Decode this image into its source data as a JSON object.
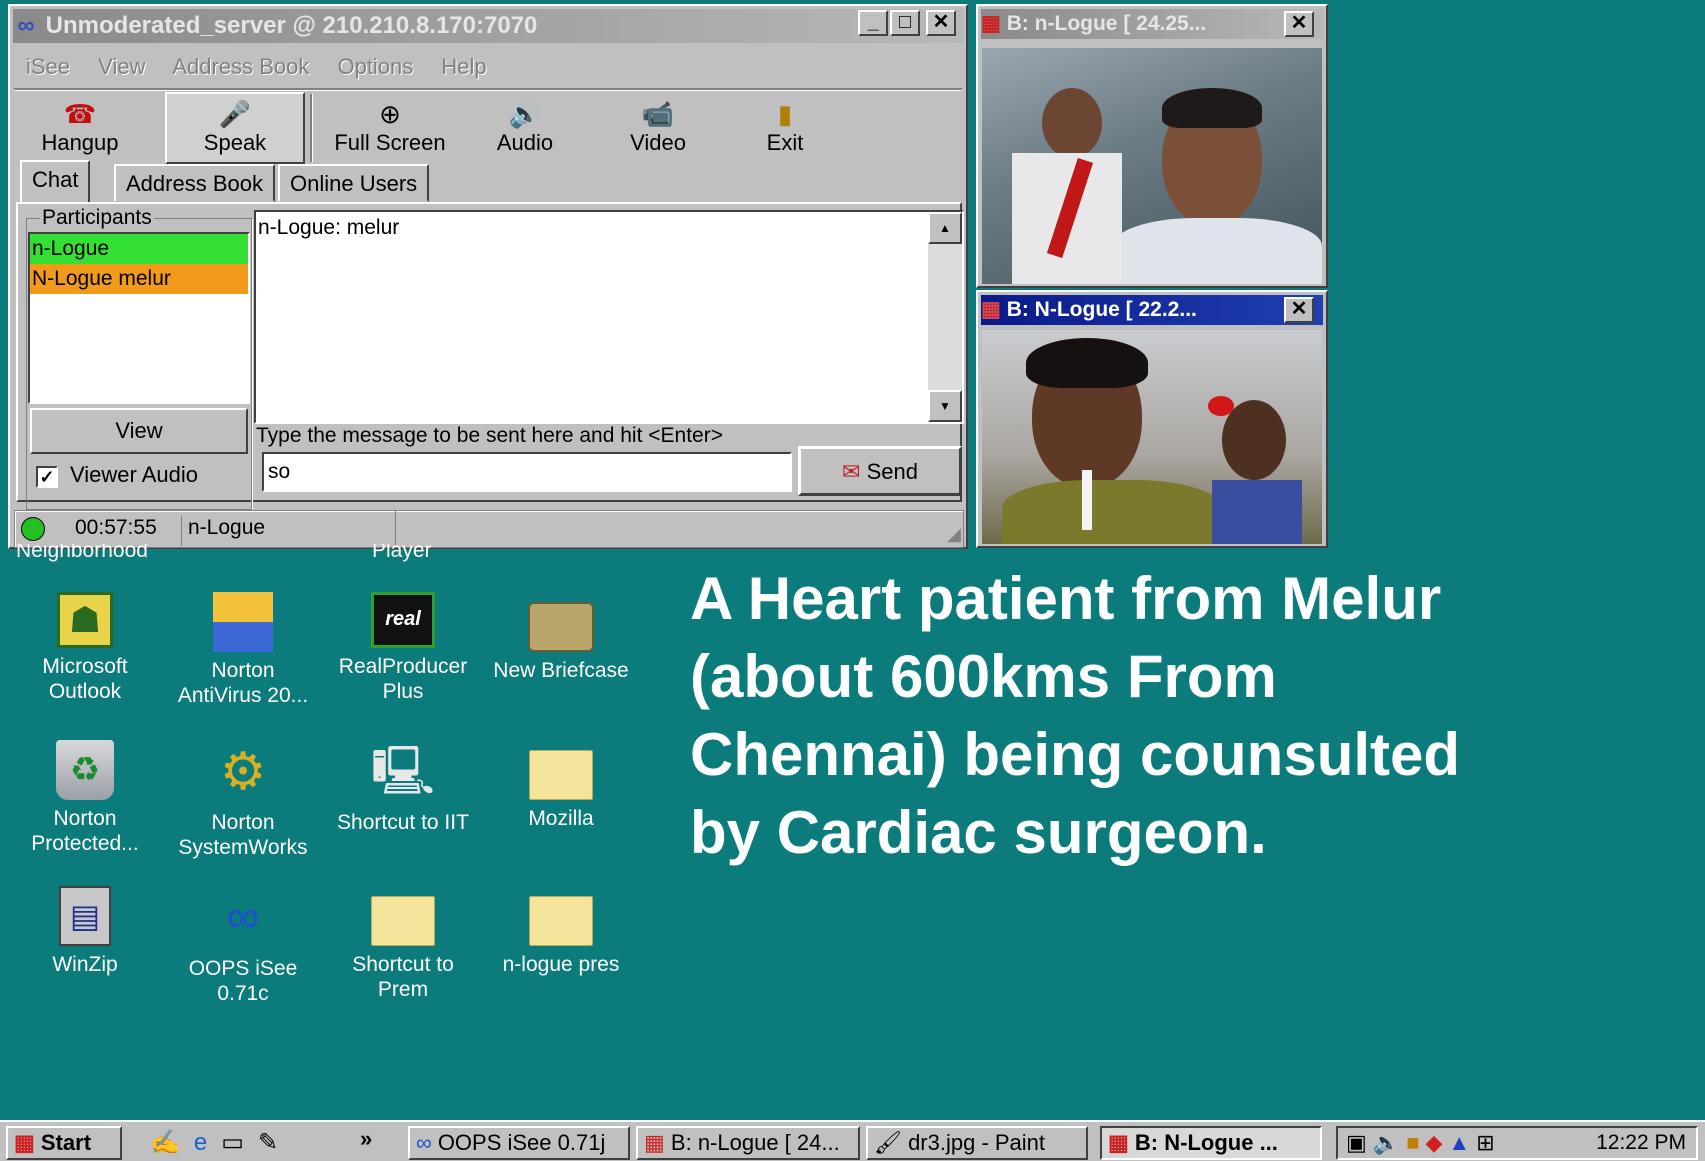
{
  "main_window": {
    "title": "Unmoderated_server @ 210.210.8.170:7070",
    "menu": [
      "iSee",
      "View",
      "Address Book",
      "Options",
      "Help"
    ],
    "toolbar": [
      {
        "label": "Hangup",
        "icon": "phone-icon"
      },
      {
        "label": "Speak",
        "icon": "microphone-icon"
      },
      {
        "label": "Full Screen",
        "icon": "magnifier-icon"
      },
      {
        "label": "Audio",
        "icon": "speaker-icon"
      },
      {
        "label": "Video",
        "icon": "camera-icon"
      },
      {
        "label": "Exit",
        "icon": "door-icon"
      }
    ],
    "tabs": [
      "Chat",
      "Address Book",
      "Online Users"
    ],
    "participants_label": "Participants",
    "participants": [
      "n-Logue",
      "N-Logue melur"
    ],
    "chat_log": "n-Logue: melur",
    "view_button": "View",
    "viewer_audio_label": "Viewer Audio",
    "viewer_audio_checked": true,
    "message_hint": "Type the message to be sent here and hit <Enter>",
    "message_value": "so",
    "send_button": "Send",
    "status_time": "00:57:55",
    "status_user": "n-Logue"
  },
  "video_windows": [
    {
      "title": "B: n-Logue [ 24.25..."
    },
    {
      "title": "B: N-Logue [ 22.2..."
    }
  ],
  "desktop": {
    "partial_labels": [
      "Neighborhood",
      "Player"
    ],
    "icons": [
      {
        "label": "Microsoft Outlook",
        "icon": "outlook-icon"
      },
      {
        "label": "Norton AntiVirus 20...",
        "icon": "norton-antivirus-icon"
      },
      {
        "label": "RealProducer Plus",
        "icon": "realproducer-icon"
      },
      {
        "label": "New Briefcase",
        "icon": "briefcase-icon"
      },
      {
        "label": "Norton Protected...",
        "icon": "recycle-bin-icon"
      },
      {
        "label": "Norton SystemWorks",
        "icon": "norton-systemworks-icon"
      },
      {
        "label": "Shortcut to IIT",
        "icon": "network-computer-icon"
      },
      {
        "label": "Mozilla",
        "icon": "folder-icon"
      },
      {
        "label": "WinZip",
        "icon": "winzip-icon"
      },
      {
        "label": "OOPS iSee 0.71c",
        "icon": "isee-icon"
      },
      {
        "label": "Shortcut to Prem",
        "icon": "folder-icon"
      },
      {
        "label": "n-logue pres",
        "icon": "folder-icon"
      }
    ],
    "caption": [
      "A Heart patient from Melur",
      "(about 600kms From",
      "Chennai) being counsulted",
      "by Cardiac surgeon."
    ]
  },
  "taskbar": {
    "start": "Start",
    "quicklaunch_more": "»",
    "tasks": [
      "OOPS iSee 0.71j",
      "B: n-Logue [ 24...",
      "dr3.jpg - Paint",
      "B: N-Logue ..."
    ],
    "clock": "12:22 PM"
  },
  "colors": {
    "desktop": "#0b7b7c",
    "participant_1": "#33e033",
    "participant_2": "#f29a1a"
  }
}
